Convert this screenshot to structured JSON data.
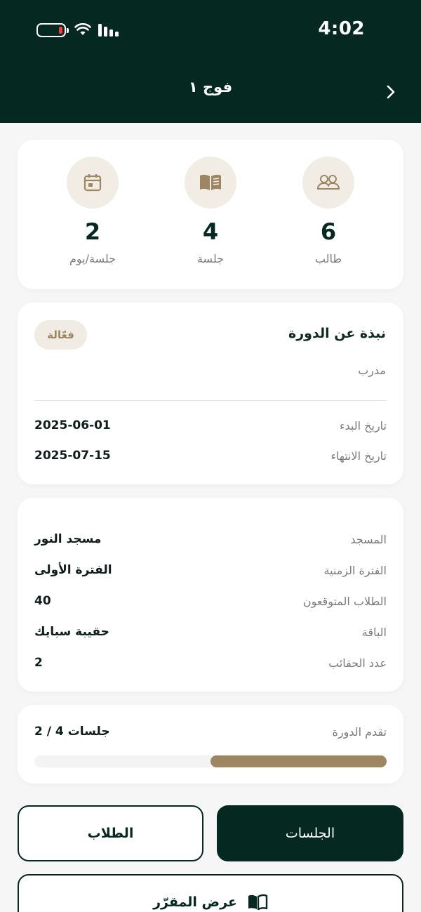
{
  "status_bar": {
    "time": "4:02"
  },
  "header": {
    "title": "فوج ١"
  },
  "stats": [
    {
      "value": "6",
      "label": "طالب",
      "icon": "users-icon"
    },
    {
      "value": "4",
      "label": "جلسة",
      "icon": "book-icon"
    },
    {
      "value": "2",
      "label": "جلسة/يوم",
      "icon": "calendar-icon"
    }
  ],
  "about": {
    "title": "نبذة عن الدورة",
    "badge": "فعّالة",
    "trainer_label": "مدرب",
    "start_label": "تاريخ البدء",
    "start_value": "2025-06-01",
    "end_label": "تاريخ الانتهاء",
    "end_value": "2025-07-15"
  },
  "details": [
    {
      "label": "المسجد",
      "value": "مسجد النور"
    },
    {
      "label": "الفترة الزمنية",
      "value": "الفترة الأولى"
    },
    {
      "label": "الطلاب المتوقعون",
      "value": "40"
    },
    {
      "label": "الباقة",
      "value": "حقيبة سبايك"
    },
    {
      "label": "عدد الحقائب",
      "value": "2"
    }
  ],
  "progress": {
    "label": "تقدم الدورة",
    "value_text": "2 / 4 جلسات",
    "completed": 2,
    "total": 4
  },
  "actions": {
    "sessions": "الجلسات",
    "students": "الطلاب",
    "curriculum": "عرض المقرّر"
  },
  "colors": {
    "header_bg": "#052820",
    "accent": "#9e8663",
    "icon_bg": "#f1ede4"
  }
}
